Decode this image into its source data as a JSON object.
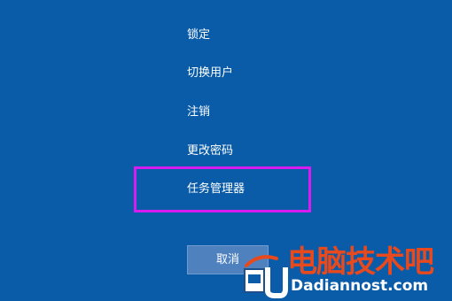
{
  "colors": {
    "background": "#0a5ca9",
    "highlight_border": "#d81cf0",
    "cancel_button": "#4f81bf",
    "watermark_red": "#e8491d"
  },
  "menu": {
    "items": [
      {
        "label": "锁定"
      },
      {
        "label": "切换用户"
      },
      {
        "label": "注销"
      },
      {
        "label": "更改密码"
      },
      {
        "label": "任务管理器"
      }
    ],
    "highlighted_item": "任务管理器"
  },
  "cancel_button": {
    "label": "取消"
  },
  "watermark": {
    "text_cn": "电脑技术吧",
    "text_en": "Dadiannost.com"
  }
}
